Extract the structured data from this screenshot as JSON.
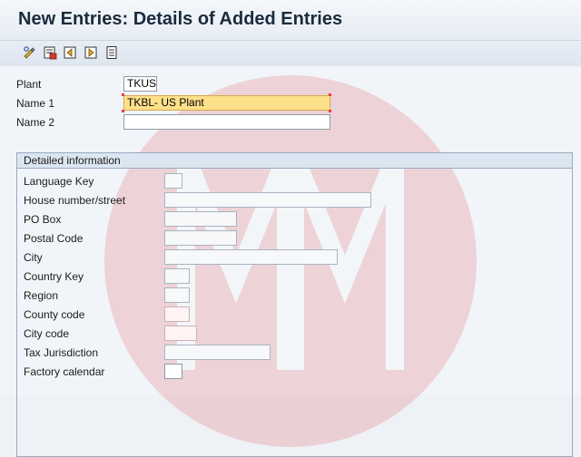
{
  "window": {
    "title": "New Entries: Details of Added Entries"
  },
  "toolbar": {
    "buttons": [
      {
        "icon": "change-display-icon"
      },
      {
        "icon": "delete-icon"
      },
      {
        "icon": "previous-entry-icon"
      },
      {
        "icon": "next-entry-icon"
      },
      {
        "icon": "document-icon"
      }
    ]
  },
  "header_fields": {
    "plant": {
      "label": "Plant",
      "value": "TKUS"
    },
    "name1": {
      "label": "Name 1",
      "value": "TKBL- US Plant"
    },
    "name2": {
      "label": "Name 2",
      "value": ""
    }
  },
  "detail": {
    "title": "Detailed information",
    "fields": [
      {
        "label": "Language Key",
        "value": ""
      },
      {
        "label": "House number/street",
        "value": ""
      },
      {
        "label": "PO Box",
        "value": ""
      },
      {
        "label": "Postal Code",
        "value": ""
      },
      {
        "label": "City",
        "value": ""
      },
      {
        "label": "Country Key",
        "value": ""
      },
      {
        "label": "Region",
        "value": ""
      },
      {
        "label": "County code",
        "value": ""
      },
      {
        "label": "City code",
        "value": ""
      },
      {
        "label": "Tax Jurisdiction",
        "value": ""
      },
      {
        "label": "Factory calendar",
        "value": ""
      }
    ]
  },
  "colors": {
    "focus_field": "#fde08a",
    "group_header": "#dbe6f1",
    "required_marker": "#e33d3d"
  }
}
